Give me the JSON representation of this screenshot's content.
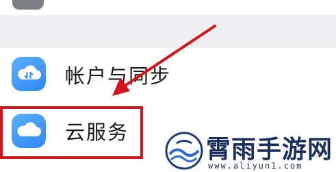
{
  "settings": {
    "items": [
      {
        "label": "帐户与同步",
        "icon": "cloud-sync-icon"
      },
      {
        "label": "云服务",
        "icon": "cloud-icon"
      }
    ]
  },
  "annotation": {
    "highlight_color": "#d4141c",
    "arrow_color": "#d4141c",
    "highlighted_item": "云服务"
  },
  "watermark": {
    "title": "霄雨手游网",
    "url": "www.aliyun1.com"
  },
  "colors": {
    "icon_blue": "#3b8ff6",
    "background": "#f3f3f5",
    "text": "#1b1b1d"
  }
}
